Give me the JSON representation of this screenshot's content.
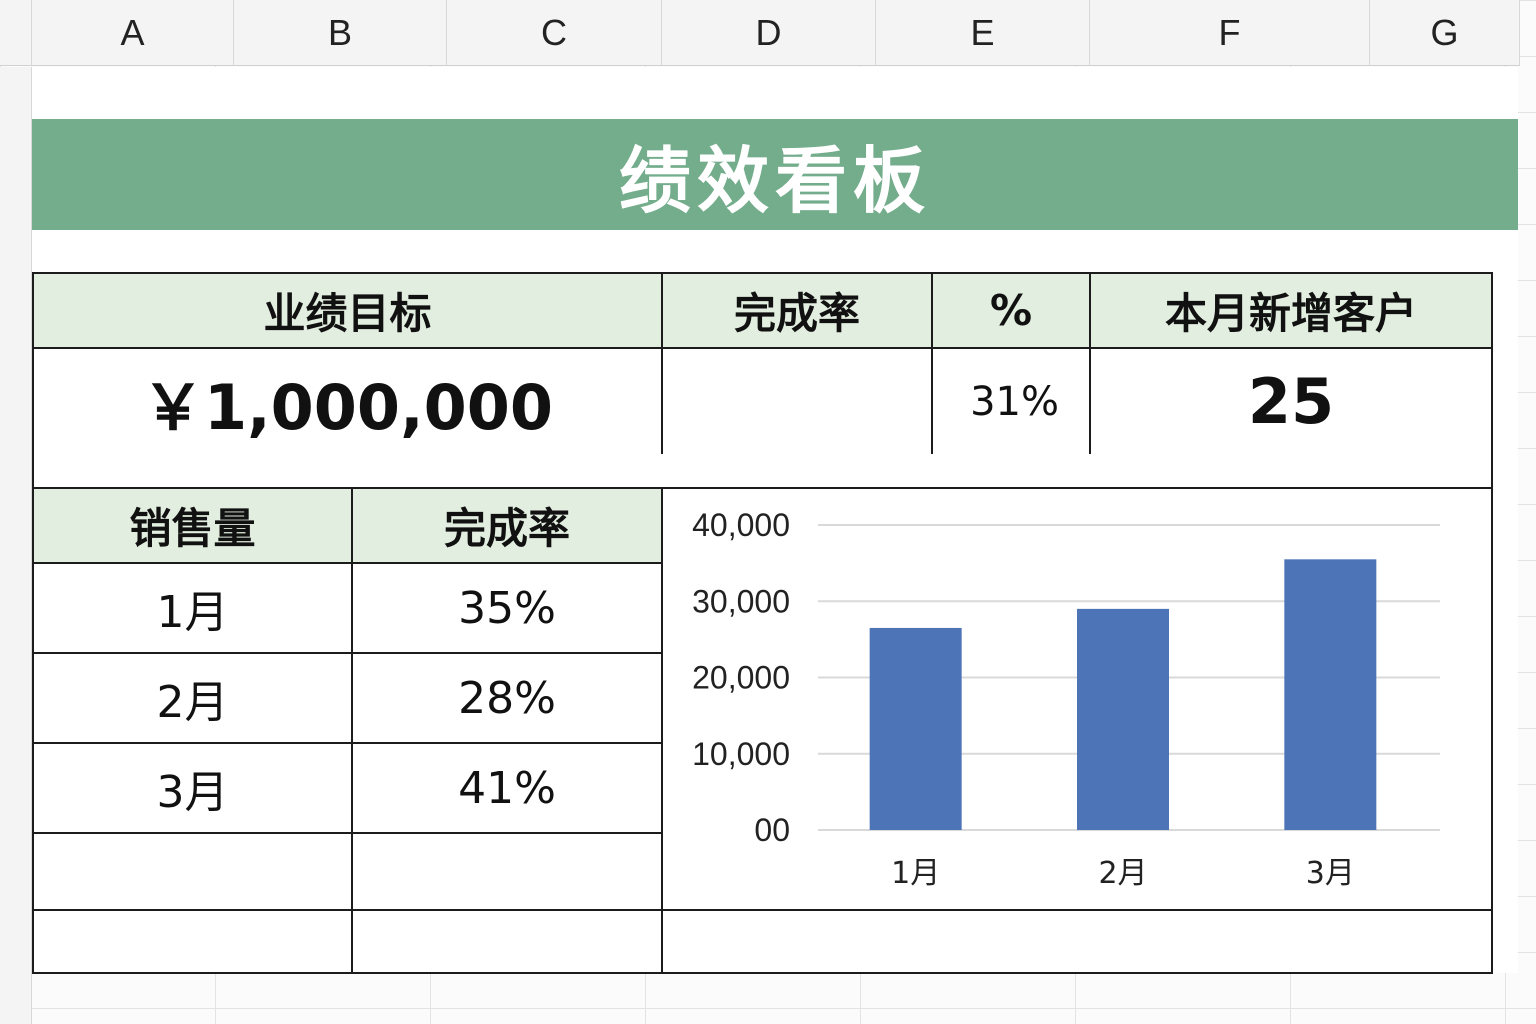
{
  "columns": [
    "A",
    "B",
    "C",
    "D",
    "E",
    "F",
    "G"
  ],
  "title": "绩效看板",
  "summary": {
    "target_label": "业绩目标",
    "target_value": "￥1,000,000",
    "rate_label": "完成率",
    "rate_value": "",
    "percent_label": "%",
    "percent_value": "31%",
    "new_customers_label": "本月新增客户",
    "new_customers_value": "25"
  },
  "table": {
    "headers": [
      "销售量",
      "完成率"
    ],
    "rows": [
      [
        "1月",
        "35%"
      ],
      [
        "2月",
        "28%"
      ],
      [
        "3月",
        "41%"
      ]
    ]
  },
  "colors": {
    "title_bar": "#73ad8c",
    "header_fill": "#e2efe0",
    "bar": "#4e74b8"
  },
  "chart_data": {
    "type": "bar",
    "categories": [
      "1月",
      "2月",
      "3月"
    ],
    "values": [
      26500,
      29000,
      35500
    ],
    "ylim": [
      0,
      40000
    ],
    "yticks": [
      "00",
      "10,000",
      "20,000",
      "30,000",
      "40,000"
    ],
    "grid": true
  }
}
